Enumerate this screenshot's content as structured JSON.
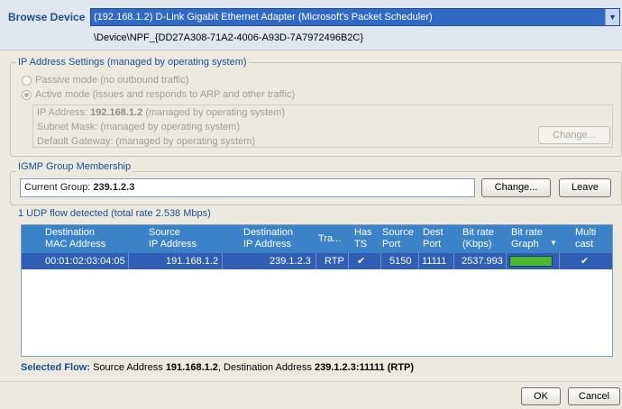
{
  "header": {
    "browse_label": "Browse Device",
    "device_selected": "(192.168.1.2) D-Link Gigabit Ethernet Adapter (Microsoft's Packet Scheduler)",
    "device_path": "\\Device\\NPF_{DD27A308-71A2-4006-A93D-7A7972496B2C}"
  },
  "ip_settings": {
    "title": "IP Address Settings (managed by operating system)",
    "passive_label": "Passive mode (no outbound traffic)",
    "active_label": "Active mode (issues and responds to ARP and other traffic)",
    "passive_checked": false,
    "active_checked": true,
    "ip_label": "IP Address:",
    "ip_value": "192.168.1.2",
    "ip_suffix": "(managed by operating system)",
    "subnet_label": "Subnet Mask: (managed by operating system)",
    "gateway_label": "Default Gateway: (managed by operating system)",
    "change_label": "Change..."
  },
  "igmp": {
    "title": "IGMP Group Membership",
    "current_label": "Current Group:",
    "current_value": "239.1.2.3",
    "change_label": "Change...",
    "leave_label": "Leave"
  },
  "udp": {
    "title": "1 UDP flow detected (total rate 2.538 Mbps)",
    "columns": {
      "dest_mac_1": "Destination",
      "dest_mac_2": "MAC Address",
      "src_ip_1": "Source",
      "src_ip_2": "IP Address",
      "dest_ip_1": "Destination",
      "dest_ip_2": "IP Address",
      "transport": "Tra...",
      "has_ts_1": "Has",
      "has_ts_2": "TS",
      "src_port_1": "Source",
      "src_port_2": "Port",
      "dest_port_1": "Dest",
      "dest_port_2": "Port",
      "bitrate_1": "Bit rate",
      "bitrate_2": "(Kbps)",
      "graph_1": "Bit rate",
      "graph_2": "Graph",
      "multi_1": "Multi",
      "multi_2": "cast"
    },
    "rows": [
      {
        "dest_mac": "00:01:02:03:04:05",
        "src_ip": "191.168.1.2",
        "dest_ip": "239.1.2.3",
        "transport": "RTP",
        "has_ts": "✔",
        "src_port": "5150",
        "dest_port": "11111",
        "bitrate": "2537.993",
        "graph_fill": 1.0,
        "multicast": "✔"
      }
    ]
  },
  "selected_flow": {
    "label": "Selected Flow:",
    "t1": "Source Address",
    "src": "191.168.1.2",
    "t2": ", Destination Address",
    "dest": "239.1.2.3:11111 (RTP)"
  },
  "footer": {
    "ok_label": "OK",
    "cancel_label": "Cancel"
  },
  "colors": {
    "header_accent": "#1f4e8c",
    "selection_blue": "#316ac5",
    "table_header_blue": "#3c82c9",
    "row_selected_blue": "#2e5fb4",
    "graph_green": "#4bb82c"
  }
}
